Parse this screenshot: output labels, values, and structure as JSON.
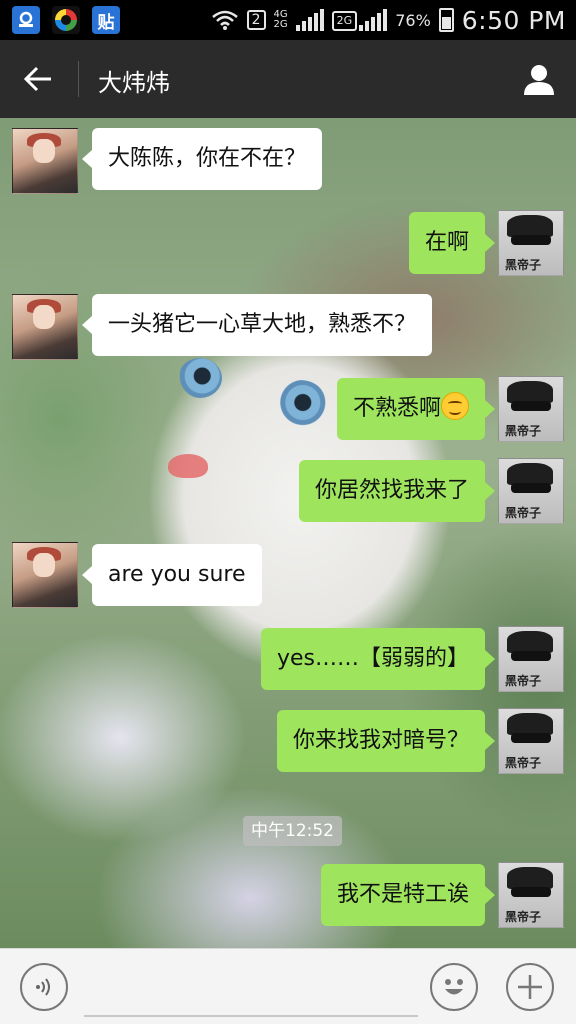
{
  "status_bar": {
    "app_icons": [
      "maps-app-icon",
      "360-app-icon",
      "tieba-app-icon"
    ],
    "tieba_label": "贴",
    "sim_label": "2",
    "net_top": "4G",
    "net_bottom": "2G",
    "net_2g": "2G",
    "battery": "76%",
    "time": "6:50 PM"
  },
  "header": {
    "title": "大炜炜",
    "back_icon": "arrow-left-icon",
    "profile_icon": "person-icon"
  },
  "messages": [
    {
      "side": "left",
      "text": "大陈陈，你在不在？"
    },
    {
      "side": "right",
      "text": "在啊"
    },
    {
      "side": "left",
      "text": "一头猪它一心草大地，熟悉不？"
    },
    {
      "side": "right",
      "text": "不熟悉啊",
      "emoji": "flushed-smile-emoji"
    },
    {
      "side": "right",
      "text": "你居然找我来了"
    },
    {
      "side": "left",
      "text": "are you sure"
    },
    {
      "side": "right",
      "text": "yes……【弱弱的】"
    },
    {
      "side": "right",
      "text": "你来找我对暗号？"
    },
    {
      "side": "right",
      "text": "我不是特工诶"
    }
  ],
  "timestamp": "中午12:52",
  "self_avatar_tag": "黑帝子",
  "input_bar": {
    "voice_icon": "voice-icon",
    "emoji_icon": "smiley-icon",
    "plus_icon": "plus-icon",
    "placeholder": ""
  },
  "colors": {
    "header_bg": "#2b2b2b",
    "self_bubble": "#9ee55d",
    "friend_bubble": "#ffffff"
  }
}
